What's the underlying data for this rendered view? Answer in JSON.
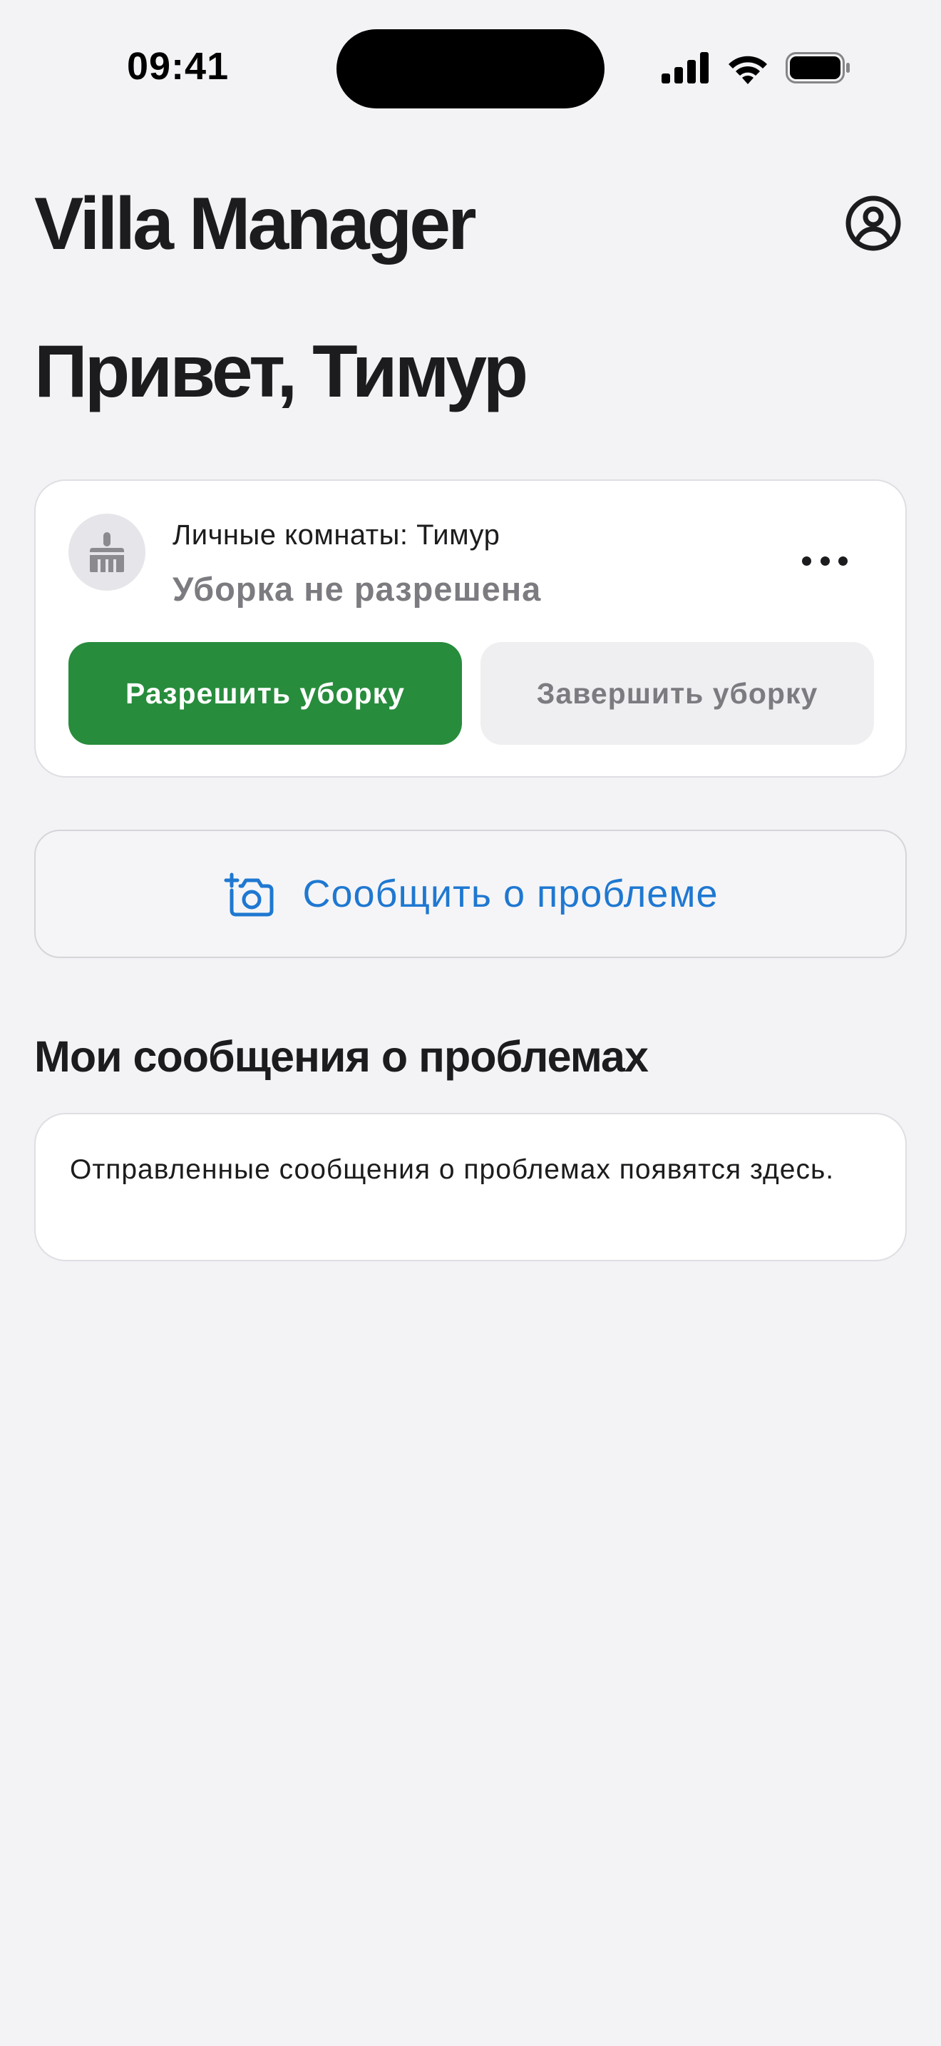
{
  "status_bar": {
    "time": "09:41"
  },
  "header": {
    "app_title": "Villa Manager",
    "profile_icon": "person-circle-icon"
  },
  "greeting": "Привет, Тимур",
  "room_card": {
    "icon": "broom-icon",
    "name": "Личные комнаты: Тимур",
    "status": "Уборка не разрешена",
    "allow_button": "Разрешить уборку",
    "finish_button": "Завершить уборку",
    "more_icon": "ellipsis-icon"
  },
  "report": {
    "icon": "camera-add-icon",
    "label": "Сообщить о проблеме"
  },
  "my_reports": {
    "title": "Мои сообщения о проблемах",
    "empty_text": "Отправленные сообщения о проблемах появятся здесь."
  },
  "colors": {
    "background": "#f3f3f6",
    "primary_green": "#278c3c",
    "link_blue": "#1f78d1",
    "muted_text": "#7b7b80"
  }
}
